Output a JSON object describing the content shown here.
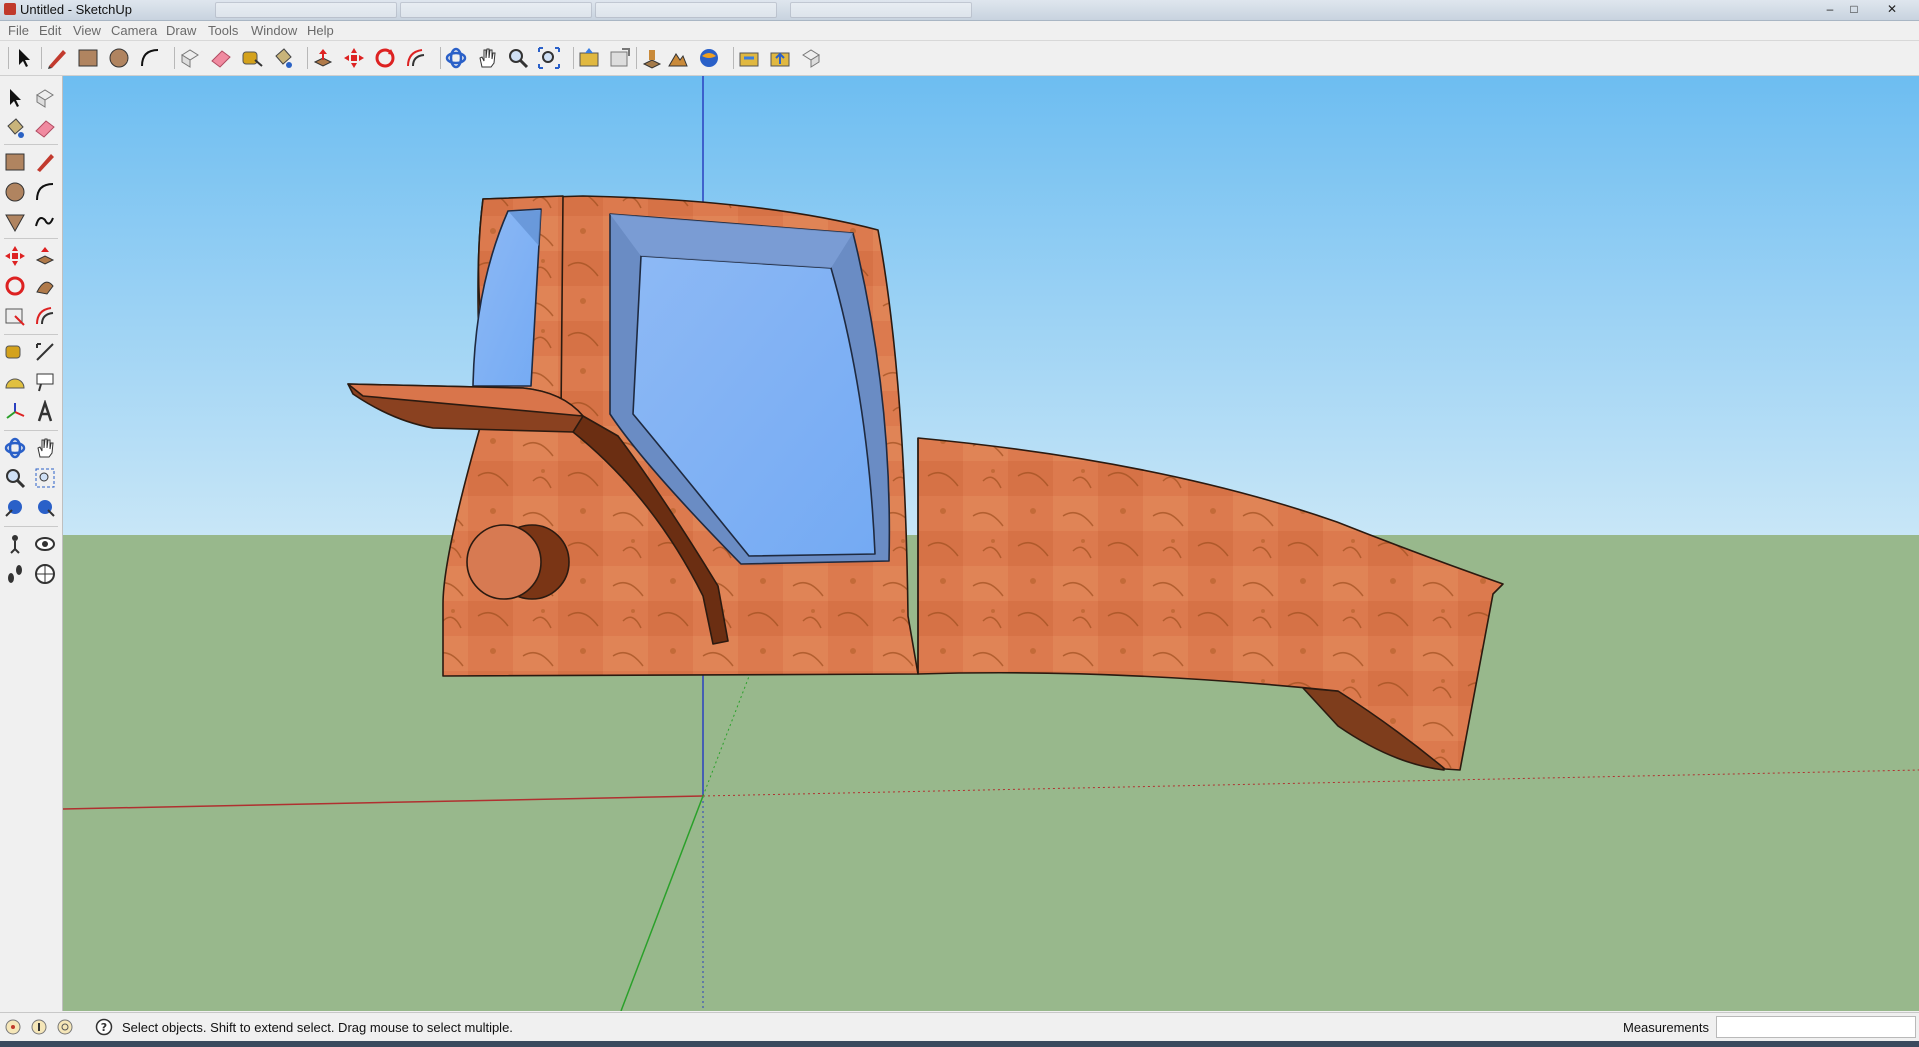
{
  "window": {
    "title": "Untitled - SketchUp",
    "minimize": "–",
    "maximize": "□",
    "close": "✕"
  },
  "menu": [
    "File",
    "Edit",
    "View",
    "Camera",
    "Draw",
    "Tools",
    "Window",
    "Help"
  ],
  "toolbar": {
    "icons": [
      "select-arrow-icon",
      "pencil-line-icon",
      "rectangle-icon",
      "circle-icon",
      "arc-icon",
      "make-component-icon",
      "eraser-icon",
      "tape-measure-icon",
      "paint-bucket-icon",
      "push-pull-icon",
      "move-icon",
      "rotate-icon",
      "offset-icon",
      "orbit-icon",
      "pan-icon",
      "zoom-icon",
      "zoom-extents-icon",
      "get-models-icon",
      "share-model-icon",
      "add-location-icon",
      "toggle-terrain-icon",
      "google-earth-icon",
      "get-components-icon",
      "share-component-icon",
      "send-to-layout-icon"
    ]
  },
  "left_toolbar": {
    "icons": [
      "select-icon",
      "make-component-icon",
      "paint-bucket-icon",
      "eraser-icon",
      "rectangle-icon",
      "line-icon",
      "circle-icon",
      "arc-icon",
      "polygon-icon",
      "freehand-icon",
      "move-icon",
      "push-pull-icon",
      "rotate-icon",
      "follow-me-icon",
      "scale-icon",
      "offset-icon",
      "tape-measure-icon",
      "dimension-icon",
      "protractor-icon",
      "text-icon",
      "axes-icon",
      "3d-text-icon",
      "orbit-icon",
      "pan-icon",
      "zoom-icon",
      "zoom-window-icon",
      "previous-view-icon",
      "next-view-icon",
      "position-camera-icon",
      "look-around-icon",
      "walk-icon",
      "section-plane-icon"
    ]
  },
  "status": {
    "message": "Select objects. Shift to extend select. Drag mouse to select multiple.",
    "measurements_label": "Measurements",
    "measurements_value": ""
  },
  "colors": {
    "sky": "#83c7f3",
    "ground": "#98b88c",
    "rust": "#d9754b",
    "glass": "#7fb1f5",
    "axis_red": "#b03030",
    "axis_green": "#2aa02a",
    "axis_blue": "#2a40c0"
  }
}
